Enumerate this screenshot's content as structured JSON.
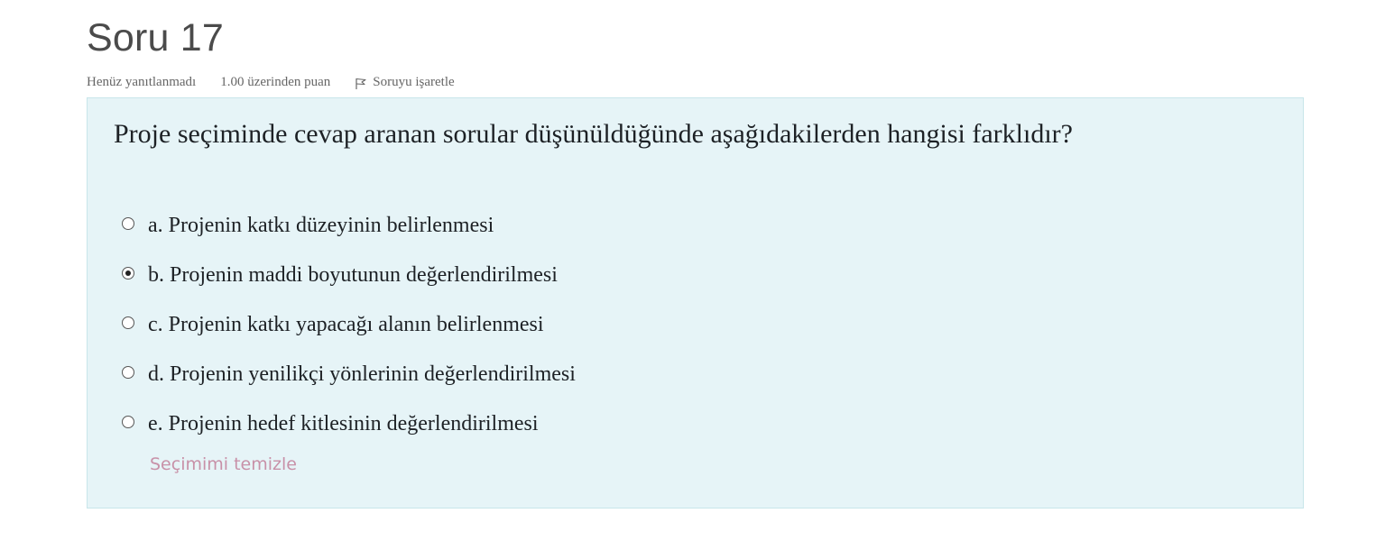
{
  "question": {
    "title": "Soru 17",
    "state": "Henüz yanıtlanmadı",
    "grade": "1.00 üzerinden puan",
    "flag_label": "Soruyu işaretle",
    "text": "Proje seçiminde cevap aranan sorular düşünüldüğünde aşağıdakilerden hangisi farklıdır?",
    "answers": [
      {
        "label": "a. Projenin katkı düzeyinin belirlenmesi",
        "selected": false
      },
      {
        "label": "b. Projenin maddi boyutunun değerlendirilmesi",
        "selected": true
      },
      {
        "label": "c. Projenin katkı yapacağı alanın belirlenmesi",
        "selected": false
      },
      {
        "label": "d. Projenin yenilikçi yönlerinin değerlendirilmesi",
        "selected": false
      },
      {
        "label": "e. Projenin hedef kitlesinin değerlendirilmesi",
        "selected": false
      }
    ],
    "clear_label": "Seçimimi temizle"
  },
  "colors": {
    "box_background": "#e6f4f7",
    "box_border": "#c8e6ea",
    "clear_link": "#c891a8",
    "title": "#4b4b4b"
  },
  "icons": {
    "flag": "flag-icon",
    "radio": "radio-button"
  }
}
